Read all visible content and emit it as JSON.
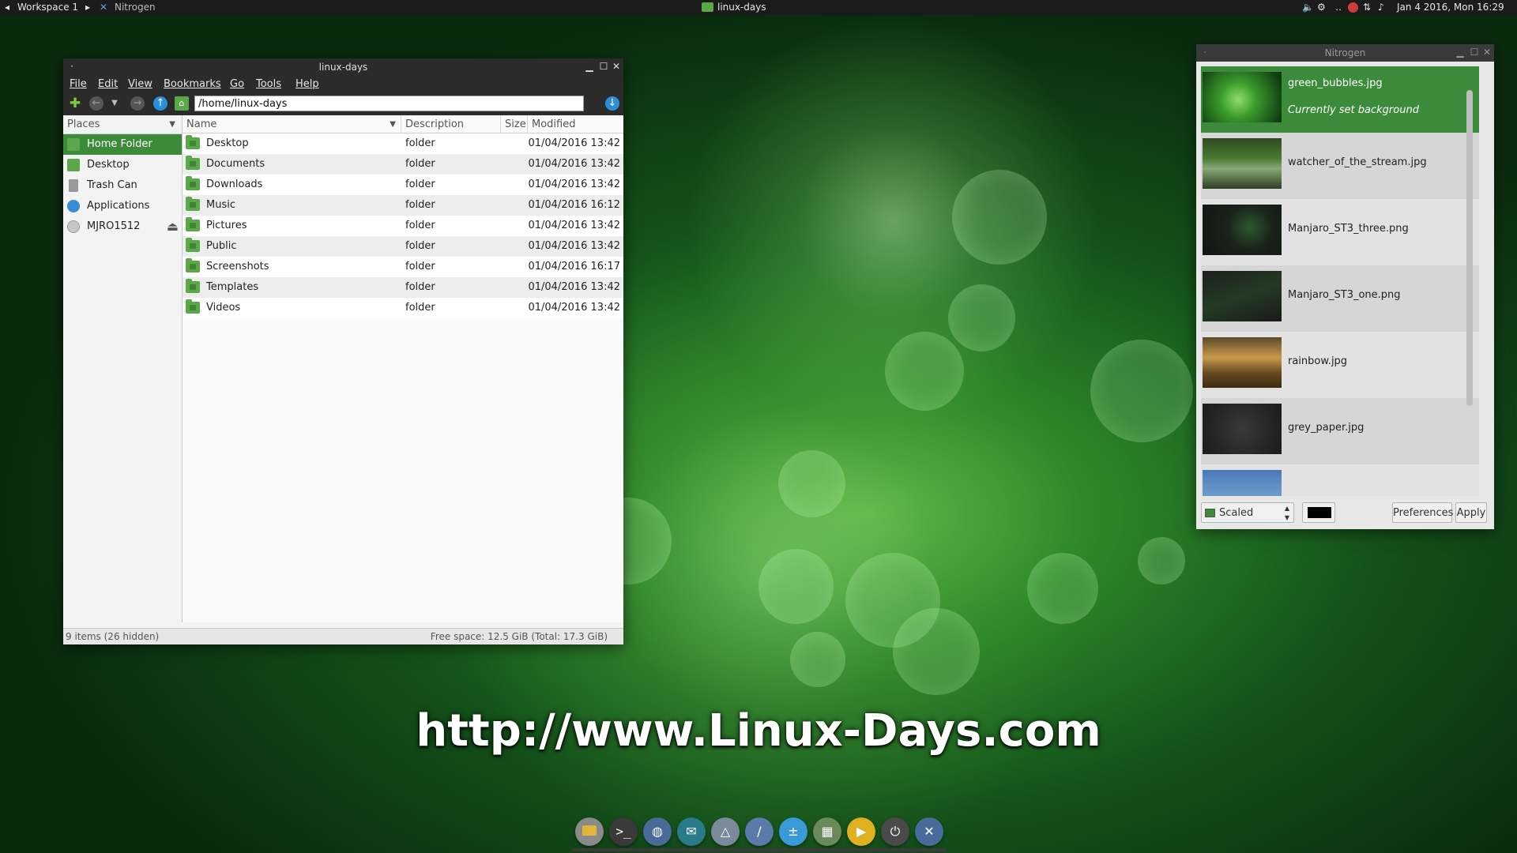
{
  "top_panel": {
    "workspace": "Workspace 1",
    "active_app": "Nitrogen",
    "task_window": "linux-days",
    "clock": "Jan  4 2016, Mon 16:29"
  },
  "file_manager": {
    "window_title": "linux-days",
    "menu": [
      "File",
      "Edit",
      "View",
      "Bookmarks",
      "Go",
      "Tools",
      "Help"
    ],
    "path": "/home/linux-days",
    "places_header": "Places",
    "places": [
      {
        "label": "Home Folder",
        "icon": "home-icon"
      },
      {
        "label": "Desktop",
        "icon": "desktop-icon"
      },
      {
        "label": "Trash Can",
        "icon": "trash-icon"
      },
      {
        "label": "Applications",
        "icon": "applications-icon"
      },
      {
        "label": "MJRO1512",
        "icon": "disc-icon"
      }
    ],
    "columns": [
      "Name",
      "Description",
      "Size",
      "Modified"
    ],
    "files": [
      {
        "name": "Desktop",
        "description": "folder",
        "size": "",
        "modified": "01/04/2016 13:42"
      },
      {
        "name": "Documents",
        "description": "folder",
        "size": "",
        "modified": "01/04/2016 13:42"
      },
      {
        "name": "Downloads",
        "description": "folder",
        "size": "",
        "modified": "01/04/2016 13:42"
      },
      {
        "name": "Music",
        "description": "folder",
        "size": "",
        "modified": "01/04/2016 16:12"
      },
      {
        "name": "Pictures",
        "description": "folder",
        "size": "",
        "modified": "01/04/2016 13:42"
      },
      {
        "name": "Public",
        "description": "folder",
        "size": "",
        "modified": "01/04/2016 13:42"
      },
      {
        "name": "Screenshots",
        "description": "folder",
        "size": "",
        "modified": "01/04/2016 16:17"
      },
      {
        "name": "Templates",
        "description": "folder",
        "size": "",
        "modified": "01/04/2016 13:42"
      },
      {
        "name": "Videos",
        "description": "folder",
        "size": "",
        "modified": "01/04/2016 13:42"
      }
    ],
    "status_left": "9 items (26 hidden)",
    "status_right": "Free space: 12.5 GiB (Total: 17.3 GiB)"
  },
  "nitrogen": {
    "window_title": "Nitrogen",
    "wallpapers": [
      {
        "name": "green_bubbles.jpg",
        "note": "Currently set background",
        "selected": true
      },
      {
        "name": "watcher_of_the_stream.jpg"
      },
      {
        "name": "Manjaro_ST3_three.png"
      },
      {
        "name": "Manjaro_ST3_one.png"
      },
      {
        "name": "rainbow.jpg"
      },
      {
        "name": "grey_paper.jpg"
      }
    ],
    "mode": "Scaled",
    "bg_color": "#000000",
    "preferences_label": "Preferences",
    "apply_label": "Apply"
  },
  "watermark": "http://www.Linux-Days.com",
  "dock": [
    "file-manager-icon",
    "terminal-icon",
    "web-browser-icon",
    "mail-icon",
    "manjaro-icon",
    "editor-icon",
    "calculator-icon",
    "spreadsheet-icon",
    "media-player-icon",
    "power-icon",
    "nitrogen-icon"
  ],
  "colors": {
    "accent": "#3c8b3a",
    "panel": "#1b1b1b"
  }
}
